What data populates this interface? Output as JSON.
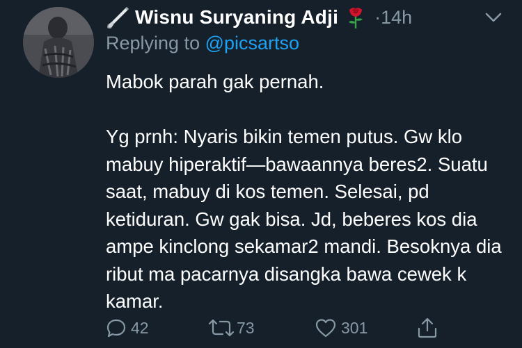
{
  "tweet": {
    "display_name": "Wisnu Suryaning Adji",
    "name_emoji_left": "paintbrush-icon",
    "name_emoji_right": "rose-icon",
    "separator": "·",
    "time": "14h",
    "replying_prefix": "Replying to",
    "replying_handle": "@picsartso",
    "body": "Mabok parah gak pernah.\n\nYg prnh: Nyaris bikin temen putus. Gw klo mabuy hiperaktif—bawaannya beres2. Suatu saat, mabuy di kos temen. Selesai, pd ketiduran. Gw gak bisa. Jd, beberes kos dia ampe kinclong sekamar2 mandi. Besoknya dia ribut ma pacarnya disangka bawa cewek k kamar."
  },
  "actions": {
    "reply_icon": "reply-icon",
    "reply_count": "42",
    "retweet_icon": "retweet-icon",
    "retweet_count": "73",
    "like_icon": "heart-icon",
    "like_count": "301",
    "share_icon": "share-icon"
  },
  "colors": {
    "background": "#15202b",
    "primary_text": "#ffffff",
    "secondary_text": "#8899a6",
    "link": "#1da1f2",
    "rose": "#d0142b"
  }
}
